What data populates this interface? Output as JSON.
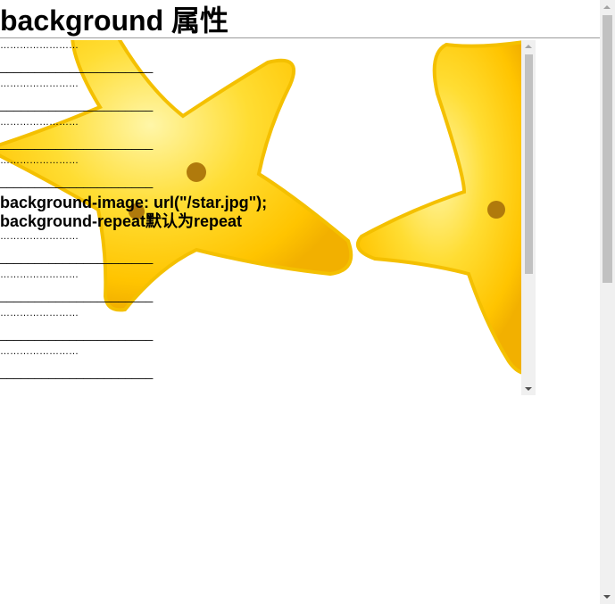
{
  "page": {
    "title": "background 属性"
  },
  "box": {
    "filler_dots": "……………………",
    "filler_underscores": "______________________",
    "code_lines": [
      "background-image: url(\"/star.jpg\");",
      "background-repeat默认为repeat"
    ],
    "background_image_icon": "star-icon"
  },
  "colors": {
    "star_fill": "#FFD21A",
    "star_highlight": "#FFF6A8",
    "star_shadow": "#F2B800",
    "star_eye": "#B07A0C",
    "scrollbar_track": "#F0F0F0",
    "scrollbar_thumb": "#C1C1C1"
  }
}
